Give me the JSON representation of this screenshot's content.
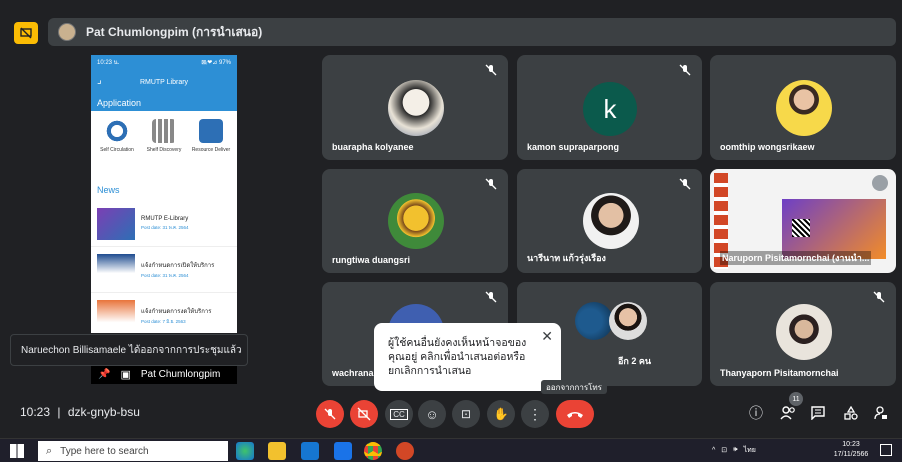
{
  "presenter_bar": {
    "label": "Pat Chumlongpim (การนำเสนอ)"
  },
  "phone": {
    "status_time": "10:23 น.",
    "status_right": "⊠ᵢ❤⊿ 97%",
    "title": "RMUTP Library",
    "application_label": "Application",
    "apps": [
      {
        "label": "Self Circulation",
        "icon": "self-circulation-icon",
        "color": "#2d6fb5"
      },
      {
        "label": "Shelf Discovery",
        "icon": "shelf-discovery-icon",
        "color": "#7a7a7a"
      },
      {
        "label": "Resource Deliver",
        "icon": "resource-delivery-icon",
        "color": "#2d6fb5"
      }
    ],
    "news_label": "News",
    "news": [
      {
        "title": "RMUTP E-Library",
        "date": "Post date: 31 พ.ค. 2564"
      },
      {
        "title": "แจ้งกำหนดการเปิดให้บริการ",
        "date": "Post date: 31 พ.ค. 2564"
      },
      {
        "title": "แจ้งกำหนดการงดให้บริการ",
        "date": "Post date: 7 มิ.ย. 2563"
      }
    ]
  },
  "pinned": {
    "name": "Pat Chumlongpim"
  },
  "participants": [
    {
      "name": "buarapha kolyanee",
      "avatar": "photo-group"
    },
    {
      "name": "kamon supraparpong",
      "avatar": "letter",
      "letter": "k",
      "color": "#0b5a4c"
    },
    {
      "name": "oomthip wongsrikaew",
      "avatar": "photo-yellow"
    },
    {
      "name": "rungtiwa duangsri",
      "avatar": "bee-icon"
    },
    {
      "name": "นารีนาท แก้วรุ่งเรือง",
      "avatar": "photo-woman"
    },
    {
      "name": "Naruporn Pisitamornchai (งานนำ...",
      "avatar": "slide"
    },
    {
      "name": "wachrana",
      "avatar": "photo-blue"
    },
    {
      "name": "อีก 2 คน",
      "avatar": "pair"
    },
    {
      "name": "Thanyaporn Pisitamornchai",
      "avatar": "photo-room"
    }
  ],
  "toast": {
    "text": "Naruechon Billisamaele ได้ออกจากการประชุมแล้ว"
  },
  "popover": {
    "text": "ผู้ใช้คนอื่นยังคงเห็นหน้าจอของคุณอยู่ คลิกเพื่อนำเสนอต่อหรือยกเลิกการนำเสนอ",
    "close": "✕"
  },
  "tooltip": {
    "text": "ออกจากการโทร"
  },
  "meeting": {
    "time": "10:23",
    "separator": "|",
    "code": "dzk-gnyb-bsu",
    "people_count": "11"
  },
  "taskbar": {
    "search_placeholder": "Type here to search",
    "lang": "ไทย",
    "time": "10:23",
    "date": "17/11/2566"
  }
}
